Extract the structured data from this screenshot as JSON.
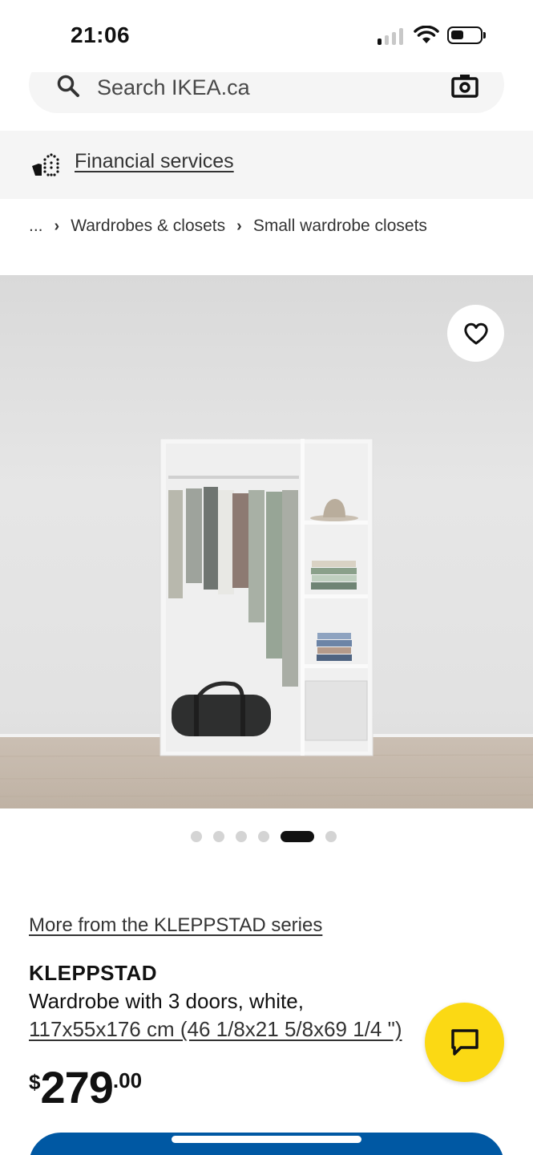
{
  "status_bar": {
    "time": "21:06"
  },
  "search": {
    "placeholder": "Search IKEA.ca"
  },
  "financial": {
    "label": "Financial services"
  },
  "breadcrumb": {
    "ellipsis": "...",
    "items": [
      "Wardrobes & closets",
      "Small wardrobe closets"
    ]
  },
  "gallery": {
    "image_count": 6,
    "active_index": 4
  },
  "product": {
    "series_link": "More from the KLEPPSTAD series",
    "name": "KLEPPSTAD",
    "description": "Wardrobe with 3 doors, white,",
    "size": "117x55x176 cm (46 1/8x21 5/8x69 1/4 \")",
    "price": {
      "currency": "$",
      "integer": "279",
      "decimal": ".00"
    }
  },
  "icons": {
    "search": "search-icon",
    "camera": "camera-icon",
    "financial": "financial-icon",
    "favorite": "heart-icon",
    "chat": "chat-icon"
  },
  "colors": {
    "ikea_blue": "#0058a3",
    "ikea_yellow": "#fbd914"
  }
}
